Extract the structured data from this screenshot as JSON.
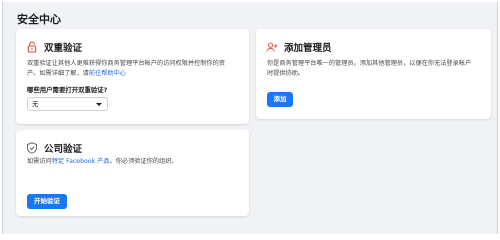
{
  "page": {
    "title": "安全中心"
  },
  "two_factor": {
    "title": "双重验证",
    "icon": "lock-icon",
    "desc_line1": "双重验证让其他人更难获得你商务管理平台帐户的访问权限并控制你的资",
    "desc_line2_prefix": "产。如需详细了解，请",
    "desc_link": "前往帮助中心",
    "question": "哪些用户需要打开双重验证?",
    "select_value": "无"
  },
  "add_admin": {
    "title": "添加管理员",
    "icon": "add-person-icon",
    "desc_line1": "你是商务管理平台唯一的管理员。添加其他管理员，以便在你无法登录帐户",
    "desc_line2": "时提供协助。",
    "button_label": "添加"
  },
  "business_verification": {
    "title": "公司验证",
    "icon": "shield-check-icon",
    "desc_prefix": "如需访问",
    "desc_link": "特定 Facebook 产品",
    "desc_suffix": "，你必须验证你的组织。",
    "button_label": "开始验证"
  },
  "colors": {
    "accent": "#1877f2",
    "link": "#216fdb",
    "background": "#f0f2f5"
  }
}
